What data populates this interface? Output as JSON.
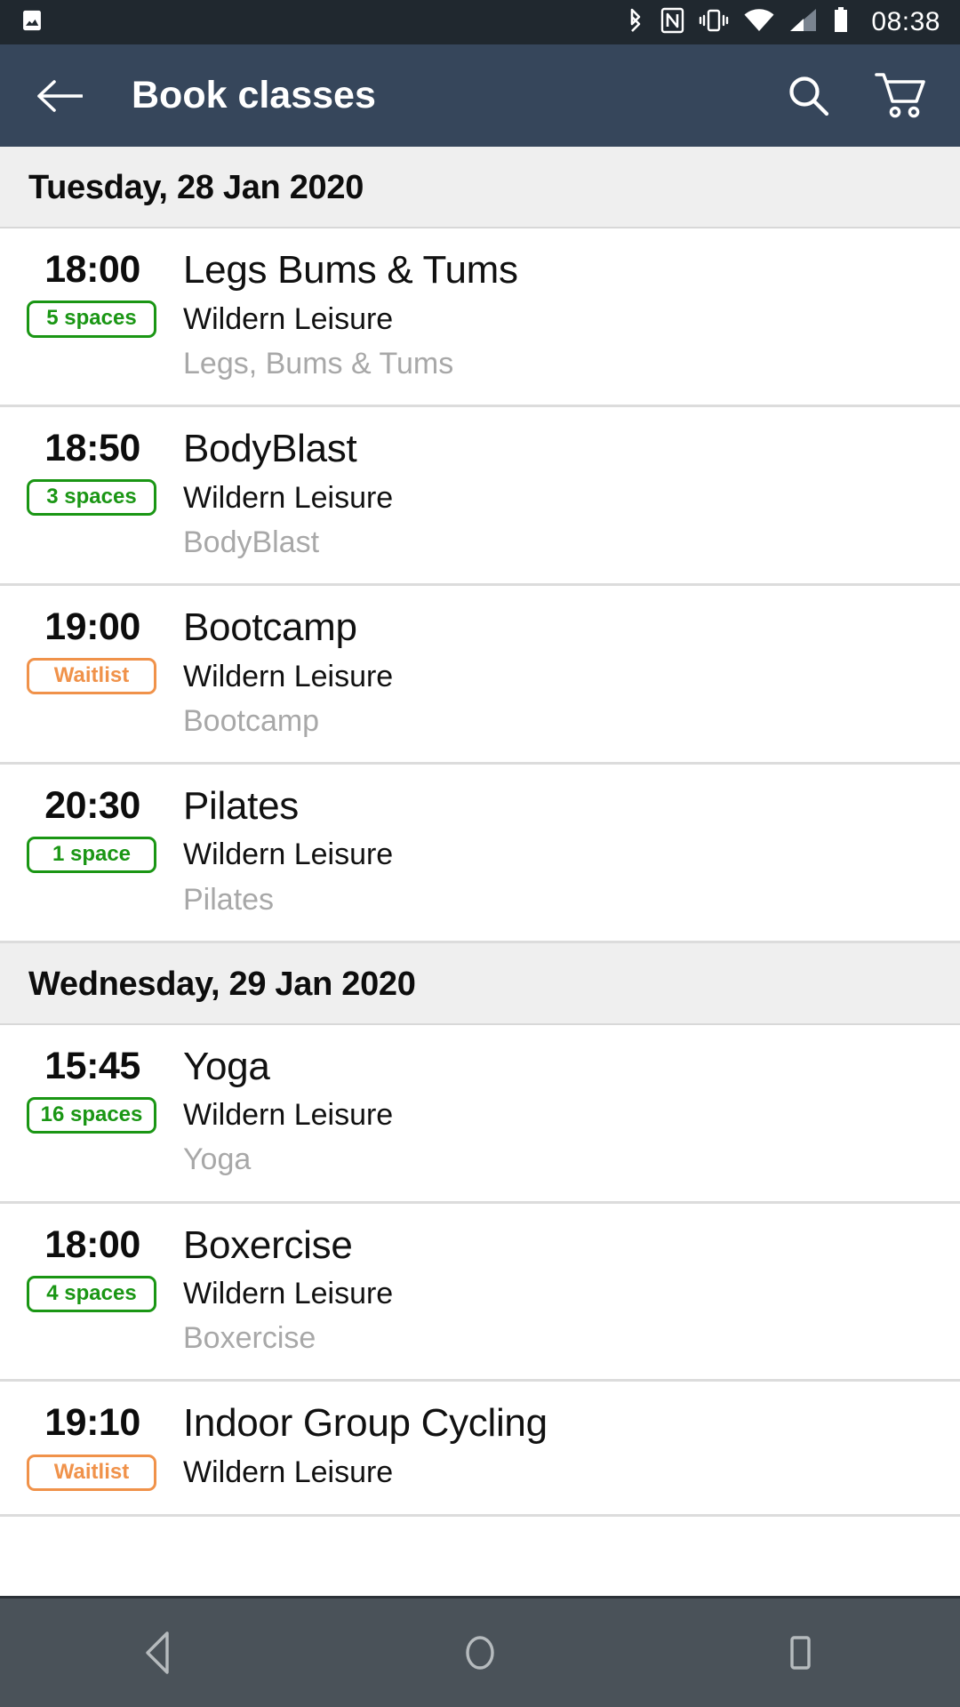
{
  "status_bar": {
    "time": "08:38",
    "icons": [
      "photo-icon",
      "bluetooth-icon",
      "nfc-icon",
      "vibrate-icon",
      "wifi-icon",
      "signal-icon",
      "battery-icon"
    ]
  },
  "toolbar": {
    "title": "Book classes",
    "back_icon": "back-arrow-icon",
    "search_icon": "search-icon",
    "cart_icon": "shopping-cart-icon"
  },
  "colors": {
    "status_bar_bg": "#20282F",
    "toolbar_bg": "#36465B",
    "date_header_bg": "#EFEFEF",
    "available_green": "#1A9614",
    "waitlist_orange": "#F0924A",
    "activity_grey": "#A8A8A8",
    "nav_bar_bg": "#4A5259"
  },
  "sections": [
    {
      "date": "Tuesday, 28 Jan 2020",
      "classes": [
        {
          "time": "18:00",
          "badge": "5 spaces",
          "badge_type": "available",
          "name": "Legs Bums & Tums",
          "venue": "Wildern Leisure",
          "activity": "Legs, Bums & Tums"
        },
        {
          "time": "18:50",
          "badge": "3 spaces",
          "badge_type": "available",
          "name": "BodyBlast",
          "venue": "Wildern Leisure",
          "activity": "BodyBlast"
        },
        {
          "time": "19:00",
          "badge": "Waitlist",
          "badge_type": "waitlist",
          "name": "Bootcamp",
          "venue": "Wildern Leisure",
          "activity": "Bootcamp"
        },
        {
          "time": "20:30",
          "badge": "1 space",
          "badge_type": "available",
          "name": "Pilates",
          "venue": "Wildern Leisure",
          "activity": "Pilates"
        }
      ]
    },
    {
      "date": "Wednesday, 29 Jan 2020",
      "classes": [
        {
          "time": "15:45",
          "badge": "16 spaces",
          "badge_type": "available",
          "name": "Yoga",
          "venue": "Wildern Leisure",
          "activity": "Yoga"
        },
        {
          "time": "18:00",
          "badge": "4 spaces",
          "badge_type": "available",
          "name": "Boxercise",
          "venue": "Wildern Leisure",
          "activity": "Boxercise"
        },
        {
          "time": "19:10",
          "badge": "Waitlist",
          "badge_type": "waitlist",
          "name": "Indoor Group Cycling",
          "venue": "Wildern Leisure",
          "activity": ""
        }
      ]
    }
  ],
  "nav_bar": {
    "back": "nav-back-icon",
    "home": "nav-home-icon",
    "recents": "nav-recents-icon"
  }
}
